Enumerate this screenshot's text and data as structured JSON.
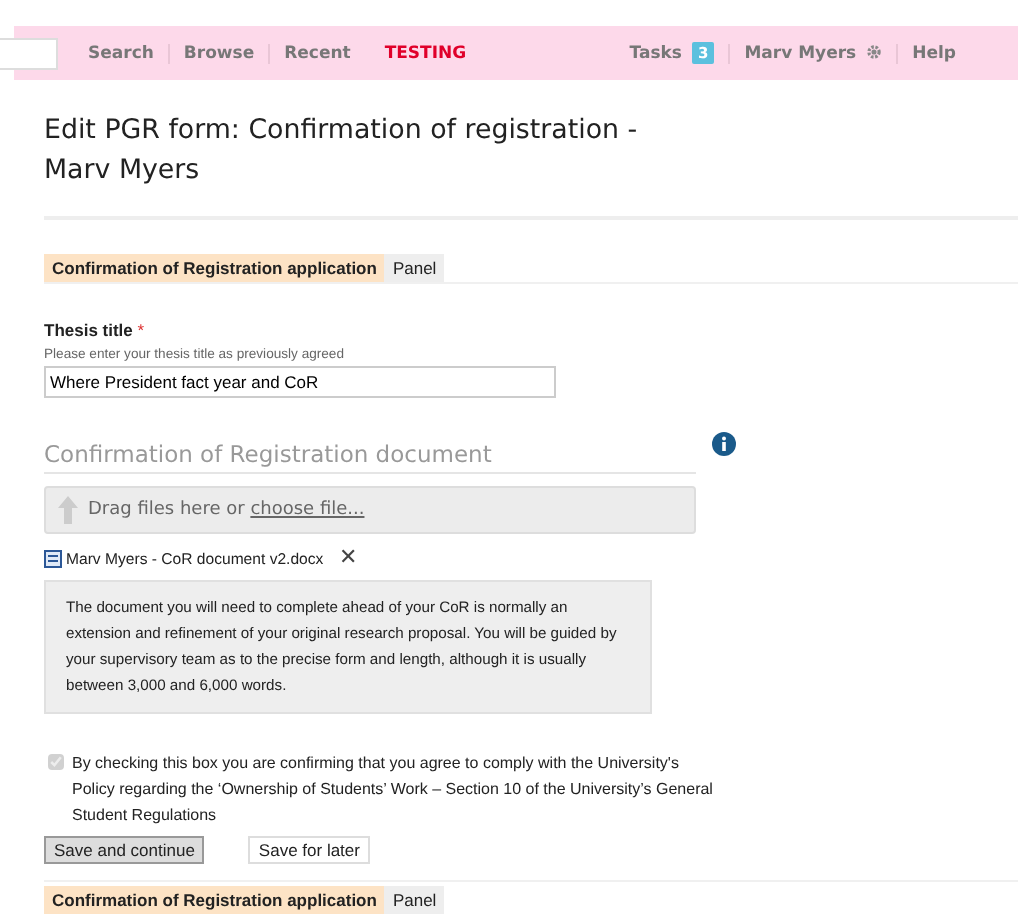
{
  "nav": {
    "items": [
      {
        "label": "Search",
        "kind": "link"
      },
      {
        "label": "Browse",
        "kind": "link"
      },
      {
        "label": "Recent",
        "kind": "link"
      },
      {
        "label": "TESTING",
        "kind": "alert"
      }
    ],
    "tasks": {
      "label": "Tasks",
      "count": "3"
    },
    "user": "Marv Myers",
    "help": "Help"
  },
  "page_title": "Edit PGR form: Confirmation of registration - Marv Myers",
  "tabs_top": [
    {
      "label": "Confirmation of Registration application",
      "selected": true
    },
    {
      "label": "Panel",
      "selected": false
    }
  ],
  "thesis": {
    "label": "Thesis title",
    "required": "*",
    "hint": "Please enter your thesis title as previously agreed",
    "value": "Where President fact year and CoR"
  },
  "document": {
    "heading": "Confirmation of Registration document",
    "drop_text": "Drag files here or ",
    "drop_link": "choose file...",
    "file": "Marv Myers - CoR document v2.docx",
    "remove": "✕",
    "info": "The document you will need to complete ahead of your CoR is normally an extension and refinement of your original research proposal. You will be guided by your supervisory team as to the precise form and length, although it is usually between 3,000 and 6,000 words."
  },
  "agreement": {
    "checked": true,
    "disabled": true,
    "text": "By checking this box you are confirming that you agree to comply with the University's Policy regarding the ‘Ownership of Students’ Work – Section 10 of the University’s General Student Regulations"
  },
  "buttons": [
    {
      "label": "Save and continue",
      "kind": "primary"
    },
    {
      "label": "Save for later",
      "kind": "secondary"
    }
  ],
  "tabs_bottom": [
    {
      "label": "Confirmation of Registration application",
      "selected": true
    },
    {
      "label": "Panel",
      "selected": false
    }
  ]
}
